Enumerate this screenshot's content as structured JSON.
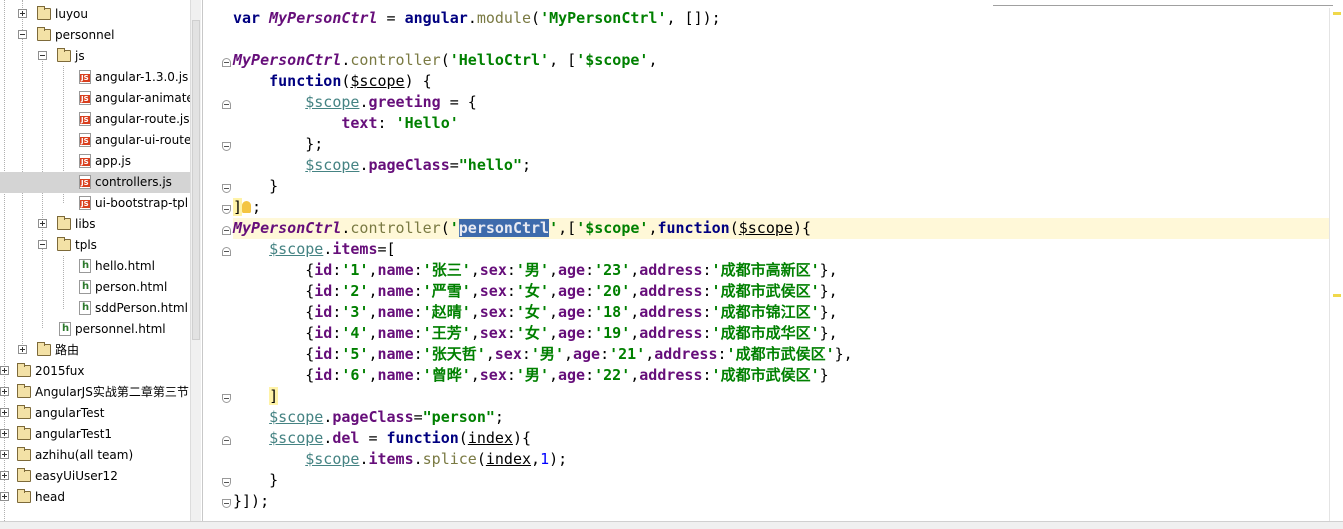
{
  "tree": {
    "items": [
      {
        "label": "luyou"
      },
      {
        "label": "personnel"
      },
      {
        "label": "js"
      },
      {
        "label": "angular-1.3.0.js"
      },
      {
        "label": "angular-animate"
      },
      {
        "label": "angular-route.js"
      },
      {
        "label": "angular-ui-route"
      },
      {
        "label": "app.js"
      },
      {
        "label": "controllers.js"
      },
      {
        "label": "ui-bootstrap-tpl"
      },
      {
        "label": "libs"
      },
      {
        "label": "tpls"
      },
      {
        "label": "hello.html"
      },
      {
        "label": "person.html"
      },
      {
        "label": "sddPerson.html"
      },
      {
        "label": "personnel.html"
      },
      {
        "label": "路由"
      },
      {
        "label": "2015fux"
      },
      {
        "label": "AngularJS实战第二章第三节"
      },
      {
        "label": "angularTest"
      },
      {
        "label": "angularTest1"
      },
      {
        "label": "azhihu(all team)"
      },
      {
        "label": "easyUiUser12"
      },
      {
        "label": "head"
      }
    ]
  },
  "editor": {
    "file": "controllers.js",
    "tokens": {
      "var": "var",
      "MyPersonCtrl": "MyPersonCtrl",
      "angular": "angular",
      "module": "module",
      "controller": "controller",
      "function": "function",
      "scope_str": "'$scope'",
      "scope_param": "$scope",
      "HelloCtrl": "'HelloCtrl'",
      "module_name": "'MyPersonCtrl'",
      "greeting": "greeting",
      "text": "text",
      "Hello": "'Hello'",
      "pageClass": "pageClass",
      "hello_str": "\"hello\"",
      "person_q1": "'",
      "personCtrl": "personCtrl",
      "person_q2": "'",
      "items": "items",
      "person_str": "\"person\"",
      "del": "del",
      "index": "index",
      "splice": "splice",
      "one": "1"
    },
    "rows": [
      {
        "id": "1",
        "name": "张三",
        "sex": "男",
        "age": "23",
        "address": "成都市高新区"
      },
      {
        "id": "2",
        "name": "严雪",
        "sex": "女",
        "age": "20",
        "address": "成都市武侯区"
      },
      {
        "id": "3",
        "name": "赵晴",
        "sex": "女",
        "age": "18",
        "address": "成都市锦江区"
      },
      {
        "id": "4",
        "name": "王芳",
        "sex": "女",
        "age": "19",
        "address": "成都市成华区"
      },
      {
        "id": "5",
        "name": "张天哲",
        "sex": "男",
        "age": "21",
        "address": "成都市武侯区"
      },
      {
        "id": "6",
        "name": "曾晔",
        "sex": "男",
        "age": "22",
        "address": "成都市武侯区"
      }
    ]
  }
}
